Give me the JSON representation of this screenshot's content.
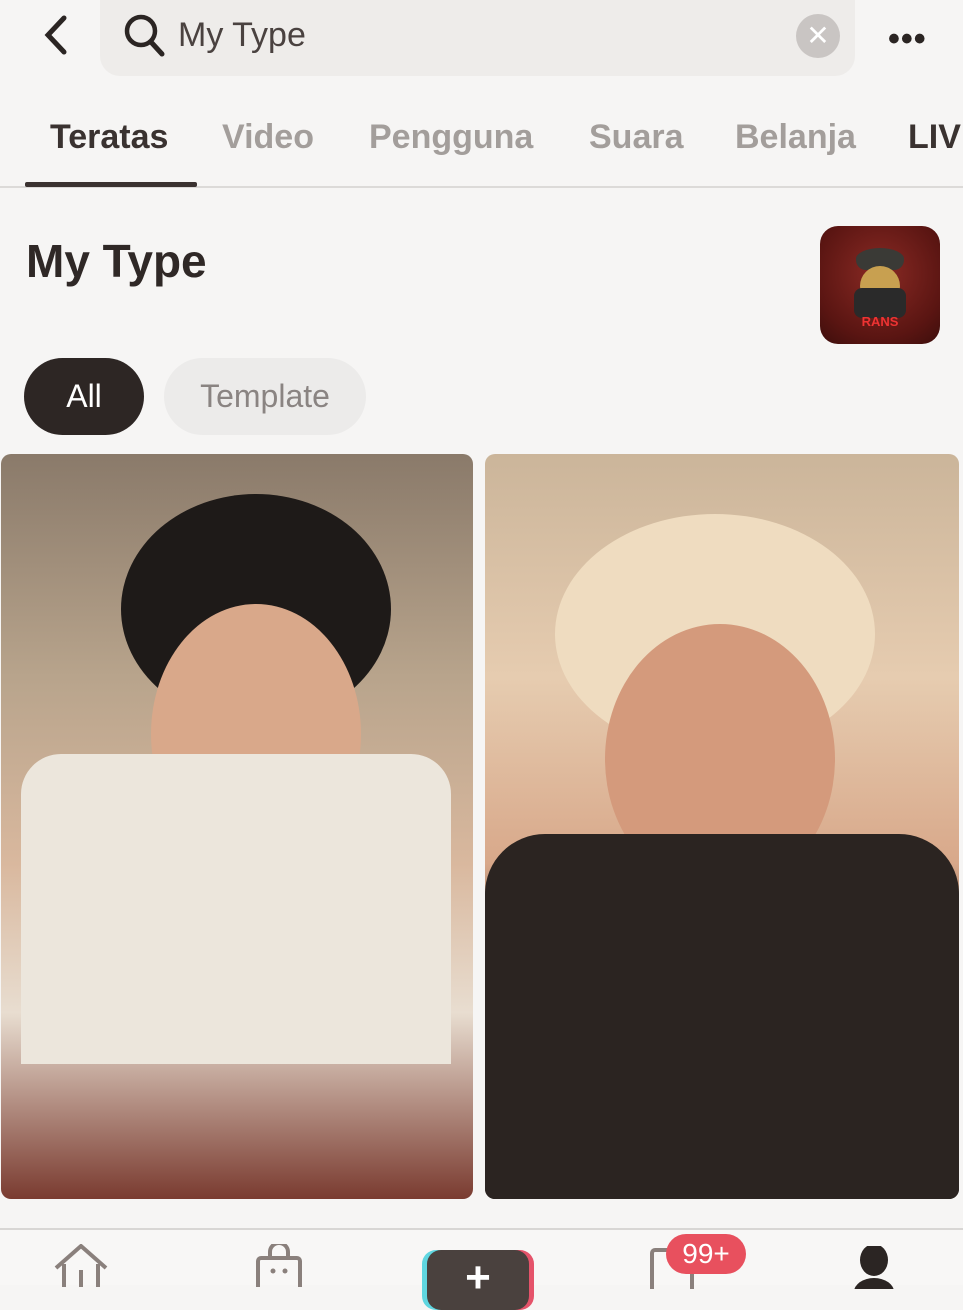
{
  "search": {
    "query": "My Type",
    "search_icon": "search-icon",
    "clear_icon": "close-icon",
    "more_icon": "more-icon"
  },
  "tabs": [
    {
      "label": "Teratas",
      "active": true
    },
    {
      "label": "Video"
    },
    {
      "label": "Pengguna"
    },
    {
      "label": "Suara"
    },
    {
      "label": "Belanja"
    },
    {
      "label": "LIV"
    }
  ],
  "result": {
    "title": "My Type",
    "app_icon_text": "RANS"
  },
  "filters": [
    {
      "label": "All",
      "selected": true
    },
    {
      "label": "Template"
    }
  ],
  "videos": [
    {
      "name": "video-1"
    },
    {
      "name": "video-2"
    }
  ],
  "bottom_nav": {
    "inbox_badge": "99+",
    "items": [
      "home-icon",
      "shop-icon",
      "create-icon",
      "inbox-icon",
      "profile-icon"
    ]
  },
  "colors": {
    "accent_red": "#e8505e",
    "cyan": "#5fd6e0",
    "dark": "#2d2624"
  }
}
